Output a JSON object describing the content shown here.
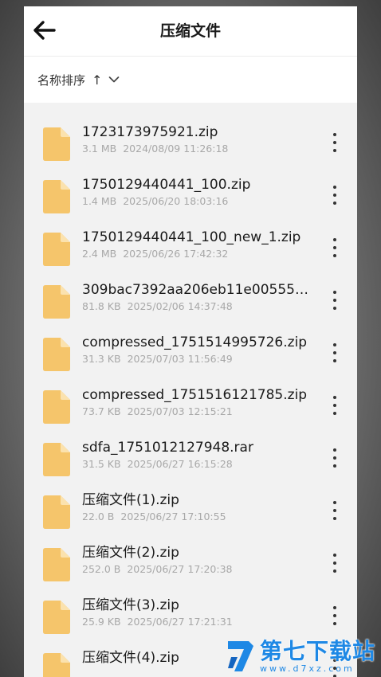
{
  "header": {
    "title": "压缩文件"
  },
  "sort": {
    "label": "名称排序",
    "direction_glyph": "↑"
  },
  "files": [
    {
      "name": "1723173975921.zip",
      "size": "3.1 MB",
      "date": "2024/08/09 11:26:18"
    },
    {
      "name": "1750129440441_100.zip",
      "size": "1.4 MB",
      "date": "2025/06/20 18:03:16"
    },
    {
      "name": "1750129440441_100_new_1.zip",
      "size": "2.4 MB",
      "date": "2025/06/26 17:42:32"
    },
    {
      "name": "309bac7392aa206eb11e00555d...",
      "size": "81.8 KB",
      "date": "2025/02/06 14:37:48"
    },
    {
      "name": "compressed_1751514995726.zip",
      "size": "31.3 KB",
      "date": "2025/07/03 11:56:49"
    },
    {
      "name": "compressed_1751516121785.zip",
      "size": "73.7 KB",
      "date": "2025/07/03 12:15:21"
    },
    {
      "name": "sdfa_1751012127948.rar",
      "size": "31.5 KB",
      "date": "2025/06/27 16:15:28"
    },
    {
      "name": "压缩文件(1).zip",
      "size": "22.0 B",
      "date": "2025/06/27 17:10:55"
    },
    {
      "name": "压缩文件(2).zip",
      "size": "252.0 B",
      "date": "2025/06/27 17:20:38"
    },
    {
      "name": "压缩文件(3).zip",
      "size": "25.9 KB",
      "date": "2025/06/27 17:21:31"
    },
    {
      "name": "压缩文件(4).zip",
      "size": "",
      "date": ""
    }
  ],
  "watermark": {
    "main": "第七下载站",
    "sub": "www.d7xz.com"
  },
  "colors": {
    "file_icon": "#f5c56b",
    "file_icon_fold": "#fbe2ae",
    "watermark": "#1e88e5"
  },
  "icons": {
    "back": "arrow-left-icon",
    "sort_toggle": "chevron-down-icon",
    "file": "file-icon",
    "more": "more-vertical-icon"
  }
}
